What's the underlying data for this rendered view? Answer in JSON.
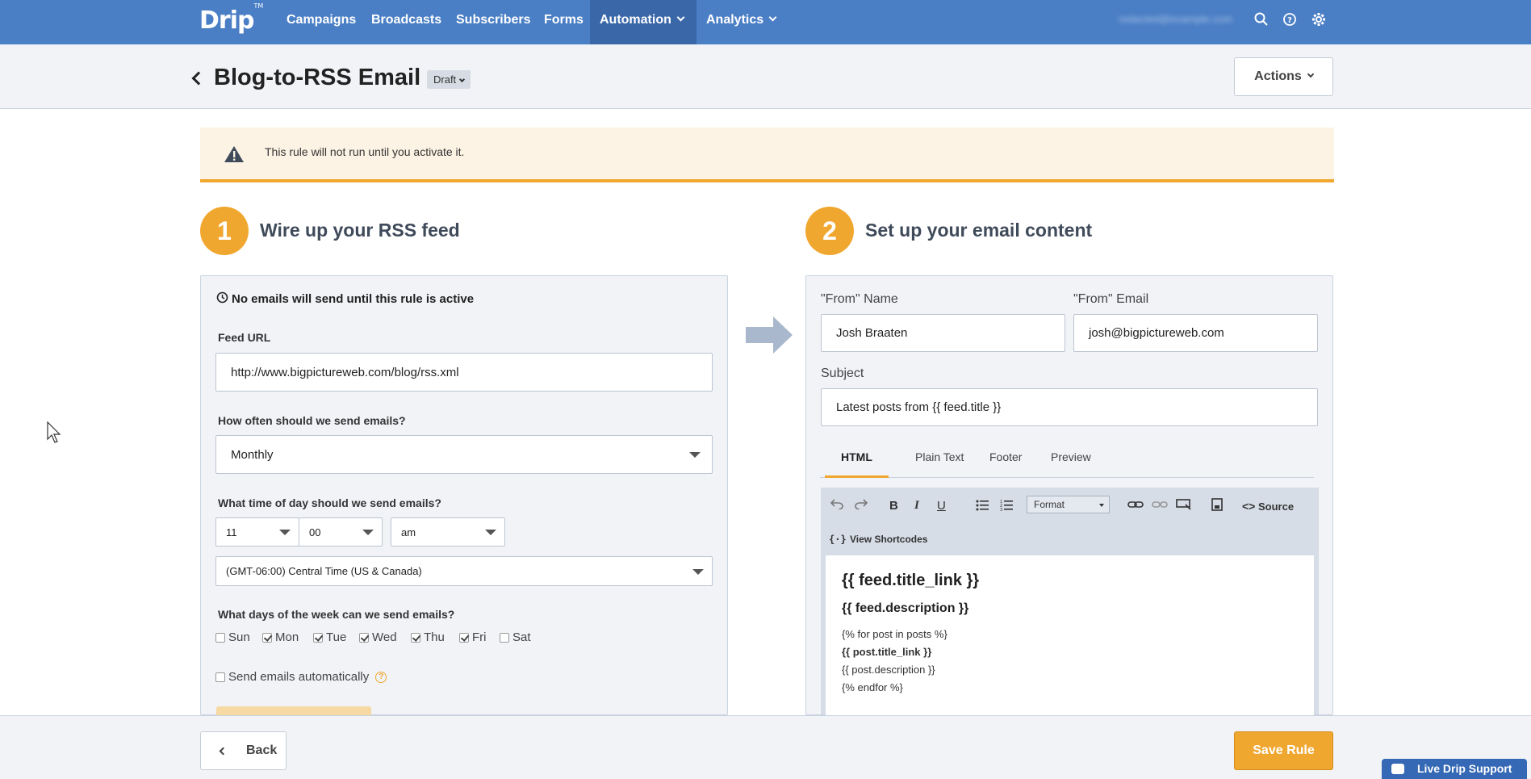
{
  "nav": {
    "logo": "Drip",
    "logo_tm": "TM",
    "items": [
      {
        "label": "Campaigns"
      },
      {
        "label": "Broadcasts"
      },
      {
        "label": "Subscribers"
      },
      {
        "label": "Forms"
      },
      {
        "label": "Automation"
      },
      {
        "label": "Analytics"
      }
    ],
    "account_email": "redacted@example.com"
  },
  "header": {
    "title": "Blog-to-RSS Email",
    "status": "Draft",
    "actions_label": "Actions"
  },
  "warning": {
    "text": "This rule will not run until you activate it."
  },
  "step1": {
    "number": "1",
    "title": "Wire up your RSS feed",
    "notice": "No emails will send until this rule is active",
    "feed_url_label": "Feed URL",
    "feed_url_value": "http://www.bigpictureweb.com/blog/rss.xml",
    "frequency_label": "How often should we send emails?",
    "frequency_value": "Monthly",
    "time_label": "What time of day should we send emails?",
    "hour": "11",
    "minute": "00",
    "ampm": "am",
    "timezone": "(GMT-06:00) Central Time (US & Canada)",
    "days_label": "What days of the week can we send emails?",
    "days": [
      {
        "label": "Sun",
        "checked": false
      },
      {
        "label": "Mon",
        "checked": true
      },
      {
        "label": "Tue",
        "checked": true
      },
      {
        "label": "Wed",
        "checked": true
      },
      {
        "label": "Thu",
        "checked": true
      },
      {
        "label": "Fri",
        "checked": true
      },
      {
        "label": "Sat",
        "checked": false
      }
    ],
    "auto_send_label": "Send emails automatically",
    "help_glyph": "?"
  },
  "step2": {
    "number": "2",
    "title": "Set up your email content",
    "from_name_label": "\"From\" Name",
    "from_name_value": "Josh Braaten",
    "from_email_label": "\"From\" Email",
    "from_email_value": "josh@bigpictureweb.com",
    "subject_label": "Subject",
    "subject_value": "Latest posts from {{ feed.title }}",
    "tabs": [
      {
        "label": "HTML"
      },
      {
        "label": "Plain Text"
      },
      {
        "label": "Footer"
      },
      {
        "label": "Preview"
      }
    ],
    "toolbar": {
      "format_label": "Format",
      "source_label": "Source",
      "shortcodes_label": "View Shortcodes"
    },
    "editor": {
      "heading": "{{ feed.title_link }}",
      "subheading": "{{ feed.description }}",
      "lines": [
        "{% for post in posts %}",
        "{{ post.title_link }}",
        "{{ post.description }}",
        "{% endfor %}"
      ]
    }
  },
  "footer": {
    "back_label": "Back",
    "save_label": "Save Rule",
    "support_label": "Live Drip Support"
  },
  "colors": {
    "nav_bg": "#4a7ec5",
    "accent": "#f0a730",
    "panel_bg": "#f1f3f7"
  }
}
